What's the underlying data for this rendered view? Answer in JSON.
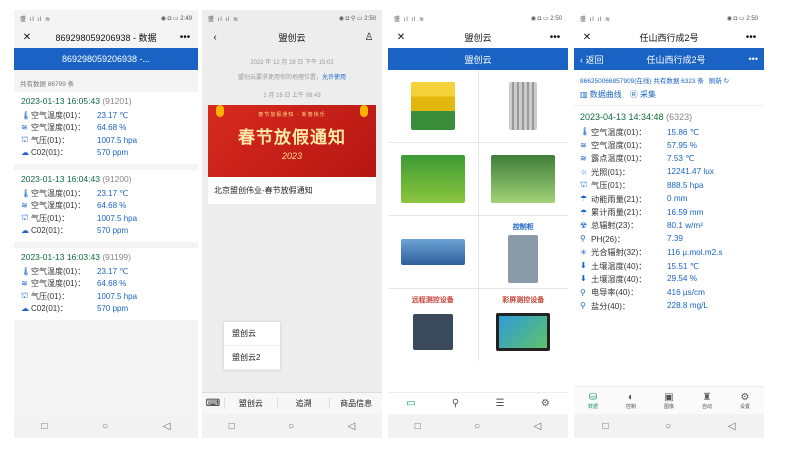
{
  "phone1": {
    "status": {
      "left": "盛 ıl ıl ≋",
      "right": "◉ ◘ ▭ 2:49"
    },
    "title": "869298059206938 - 数据",
    "tab": "869298059206938 -...",
    "count": "共有数据 86799 条",
    "records": [
      {
        "time": "2023-01-13 16:05:43",
        "id": "(91201)",
        "rows": [
          {
            "icon": "thermometer-icon",
            "glyph": "🌡",
            "label": "空气温度(01)：",
            "value": "23.17 ℃"
          },
          {
            "icon": "humidity-icon",
            "glyph": "≋",
            "label": "空气湿度(01)：",
            "value": "64.68 %"
          },
          {
            "icon": "pressure-icon",
            "glyph": "⛫",
            "label": "气压(01)：",
            "value": "1007.5 hpa"
          },
          {
            "icon": "cloud-icon",
            "glyph": "☁",
            "label": "C02(01)：",
            "value": "570 ppm"
          }
        ]
      },
      {
        "time": "2023-01-13 16:04:43",
        "id": "(91200)",
        "rows": [
          {
            "icon": "thermometer-icon",
            "glyph": "🌡",
            "label": "空气温度(01)：",
            "value": "23.17 ℃"
          },
          {
            "icon": "humidity-icon",
            "glyph": "≋",
            "label": "空气湿度(01)：",
            "value": "64.68 %"
          },
          {
            "icon": "pressure-icon",
            "glyph": "⛫",
            "label": "气压(01)：",
            "value": "1007.5 hpa"
          },
          {
            "icon": "cloud-icon",
            "glyph": "☁",
            "label": "C02(01)：",
            "value": "570 ppm"
          }
        ]
      },
      {
        "time": "2023-01-13 16:03:43",
        "id": "(91199)",
        "rows": [
          {
            "icon": "thermometer-icon",
            "glyph": "🌡",
            "label": "空气温度(01)：",
            "value": "23.17 ℃"
          },
          {
            "icon": "humidity-icon",
            "glyph": "≋",
            "label": "空气湿度(01)：",
            "value": "64.68 %"
          },
          {
            "icon": "pressure-icon",
            "glyph": "⛫",
            "label": "气压(01)：",
            "value": "1007.5 hpa"
          },
          {
            "icon": "cloud-icon",
            "glyph": "☁",
            "label": "C02(01)：",
            "value": "570 ppm"
          }
        ]
      }
    ]
  },
  "phone2": {
    "status": {
      "left": "盛 ıl ıl ≋",
      "right": "◉ ◘ ⚲ ▭ 2:50"
    },
    "title": "盟创云",
    "date1": "2022 年 12 月 28 日 下午 15:02",
    "notice": "盟创云要求使用你的地理位置，",
    "notice_link": "允许使用",
    "date2": "1 月 16 日 上午 08:43",
    "banner_top": "春节放假通知 · 新春快乐",
    "banner_title": "春节放假通知",
    "banner_year": "2023",
    "card_caption": "北京盟创伟业-春节放假通知",
    "popup": [
      "盟创云",
      "盟创云2"
    ],
    "menu": [
      "盟创云",
      "追溯",
      "商品信息"
    ]
  },
  "phone3": {
    "status": {
      "left": "盛 ıl ıl ≋",
      "right": "◉ ◘ ▭ 2:50"
    },
    "title": "盟创云",
    "tab": "盟创云",
    "labels": [
      "",
      "",
      "",
      "",
      "",
      "控制柜",
      "远程测控设备",
      "彩屏测控设备"
    ]
  },
  "phone4": {
    "status": {
      "left": "盛 ıl ıl ≋",
      "right": "◉ ◘ ▭ 2:50"
    },
    "title": "任山西行成2号",
    "back": "返回",
    "header": "任山西行成2号",
    "sub": "866250066857909(在线) 共有数据 6323 条",
    "refresh": "刷新",
    "tab_curve": "数据曲线",
    "tab_collect": "采集",
    "time": "2023-04-13 14:34:48",
    "id": "(6323)",
    "rows": [
      {
        "icon": "thermometer-icon",
        "glyph": "🌡",
        "label": "空气温度(01)：",
        "value": "15.86 ℃"
      },
      {
        "icon": "humidity-icon",
        "glyph": "≋",
        "label": "空气湿度(01)：",
        "value": "57.95 %"
      },
      {
        "icon": "dewpoint-icon",
        "glyph": "≋",
        "label": "露点温度(01)：",
        "value": "7.53 ℃"
      },
      {
        "icon": "sun-icon",
        "glyph": "☼",
        "label": "光照(01)：",
        "value": "12241.47 lux"
      },
      {
        "icon": "pressure-icon",
        "glyph": "⛫",
        "label": "气压(01)：",
        "value": "888.5 hpa"
      },
      {
        "icon": "rain-icon",
        "glyph": "☂",
        "label": "动能雨量(21)：",
        "value": "0 mm"
      },
      {
        "icon": "rain-icon",
        "glyph": "☂",
        "label": "累计雨量(21)：",
        "value": "16.59 mm"
      },
      {
        "icon": "radiation-icon",
        "glyph": "☢",
        "label": "总辐射(23)：",
        "value": "80.1 w/m²"
      },
      {
        "icon": "person-icon",
        "glyph": "⚲",
        "label": "PH(26)：",
        "value": "7.39"
      },
      {
        "icon": "star-icon",
        "glyph": "✳",
        "label": "光合辐射(32)：",
        "value": "116 µ.mol.m2.s"
      },
      {
        "icon": "soil-temp-icon",
        "glyph": "⬇",
        "label": "土壤温度(40)：",
        "value": "15.51 ℃"
      },
      {
        "icon": "soil-moist-icon",
        "glyph": "⬇",
        "label": "土壤湿度(40)：",
        "value": "29.54 %"
      },
      {
        "icon": "person-icon",
        "glyph": "⚲",
        "label": "电导率(40)：",
        "value": "416 µs/cm"
      },
      {
        "icon": "person-icon",
        "glyph": "⚲",
        "label": "盐分(40)：",
        "value": "228.8 mg/L"
      }
    ],
    "tabs": [
      "数据",
      "控制",
      "图像",
      "自动",
      "设置"
    ]
  }
}
